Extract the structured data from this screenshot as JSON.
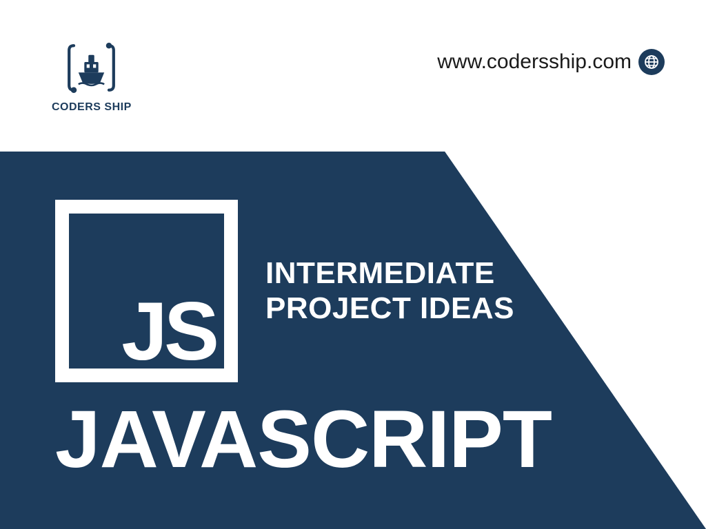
{
  "header": {
    "logo_text": "CODERS SHIP",
    "url": "www.codersship.com"
  },
  "banner": {
    "js_label": "JS",
    "subtitle_line1": "INTERMEDIATE",
    "subtitle_line2": "PROJECT IDEAS",
    "main_title": "JAVASCRIPT"
  },
  "colors": {
    "primary": "#1d3c5c",
    "text_dark": "#1a1a1a",
    "white": "#ffffff"
  }
}
